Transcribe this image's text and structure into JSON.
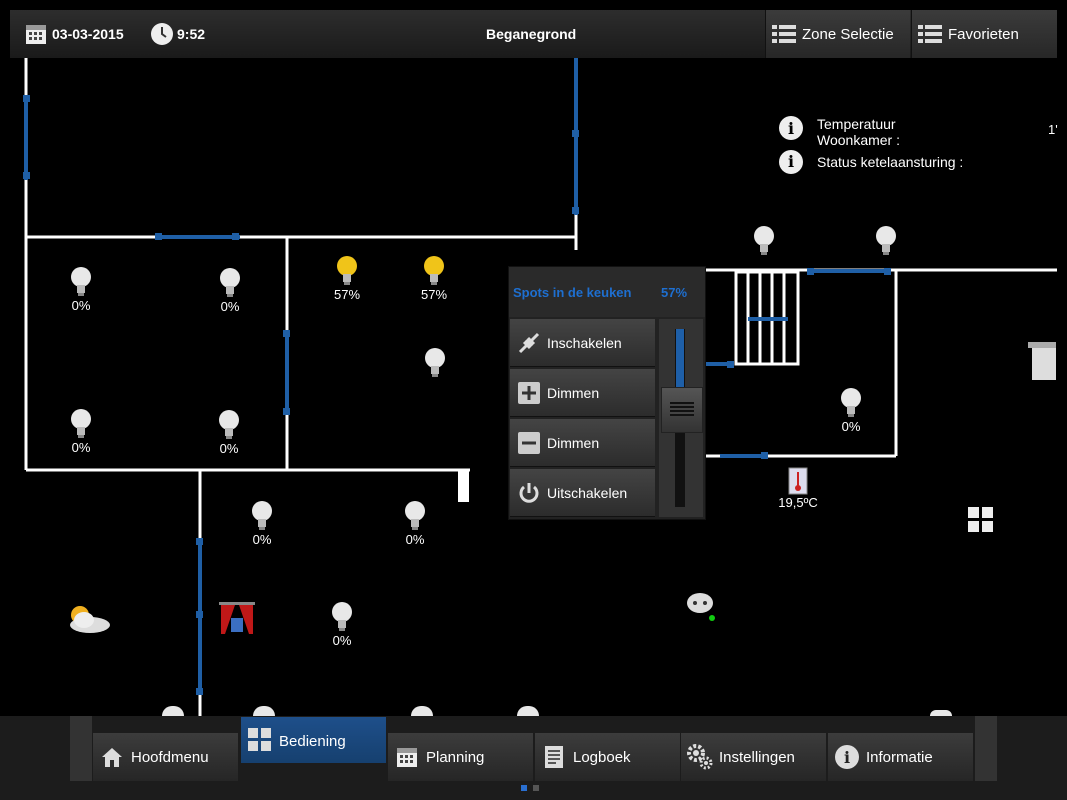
{
  "header": {
    "date": "03-03-2015",
    "time": "9:52",
    "title": "Beganegrond",
    "zone_label": "Zone Selectie",
    "favorites_label": "Favorieten"
  },
  "info": {
    "temp_label": "Temperatuur\nWoonkamer :",
    "temp_value": "1'",
    "status_label": "Status ketelaansturing :"
  },
  "lamps": {
    "l1": "0%",
    "l2": "0%",
    "l3": "57%",
    "l4": "57%",
    "l5": "0%",
    "l6": "0%",
    "l7": "0%",
    "l8": "0%",
    "l9": "0%",
    "l10": "0%"
  },
  "lamp_right_value": "0%",
  "thermometer_value": "19,5ºC",
  "popup": {
    "title": "Spots in de keuken",
    "value": "57%",
    "level": 0.57,
    "buttons": [
      {
        "label": "Inschakelen",
        "icon": "plug-icon"
      },
      {
        "label": "Dimmen",
        "icon": "plus-icon"
      },
      {
        "label": "Dimmen",
        "icon": "minus-icon"
      },
      {
        "label": "Uitschakelen",
        "icon": "power-icon"
      }
    ]
  },
  "nav": {
    "home": "Hoofdmenu",
    "control": "Bediening",
    "planning": "Planning",
    "log": "Logboek",
    "settings": "Instellingen",
    "information": "Informatie"
  },
  "colors": {
    "accent": "#1e6fd0",
    "wall": "#ffffff",
    "pipe": "#1f5fa6",
    "lamp_on": "#f0c419"
  }
}
